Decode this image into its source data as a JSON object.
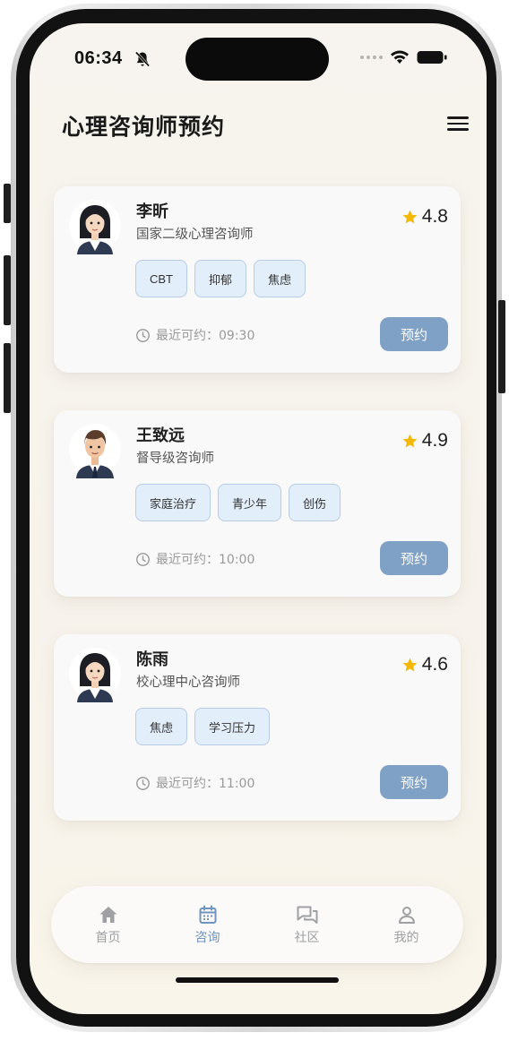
{
  "status_bar": {
    "time": "06:34"
  },
  "header": {
    "title": "心理咨询师预约"
  },
  "counselors": [
    {
      "name": "李昕",
      "title": "国家二级心理咨询师",
      "rating": "4.8",
      "tags": [
        "CBT",
        "抑郁",
        "焦虑"
      ],
      "availability": "最近可约：09:30",
      "book_label": "预约",
      "avatar": "female"
    },
    {
      "name": "王致远",
      "title": "督导级咨询师",
      "rating": "4.9",
      "tags": [
        "家庭治疗",
        "青少年",
        "创伤"
      ],
      "availability": "最近可约：10:00",
      "book_label": "预约",
      "avatar": "male"
    },
    {
      "name": "陈雨",
      "title": "校心理中心咨询师",
      "rating": "4.6",
      "tags": [
        "焦虑",
        "学习压力"
      ],
      "availability": "最近可约：11:00",
      "book_label": "预约",
      "avatar": "female"
    }
  ],
  "tabbar": {
    "tabs": [
      {
        "label": "首页",
        "icon": "home-icon"
      },
      {
        "label": "咨询",
        "icon": "calendar-icon",
        "active": true
      },
      {
        "label": "社区",
        "icon": "chat-icon"
      },
      {
        "label": "我的",
        "icon": "user-icon"
      }
    ]
  },
  "colors": {
    "accent": "#7fa1c6",
    "tab_active": "#6f94bf",
    "star": "#f5b800",
    "tag_bg": "#e3eefb"
  }
}
